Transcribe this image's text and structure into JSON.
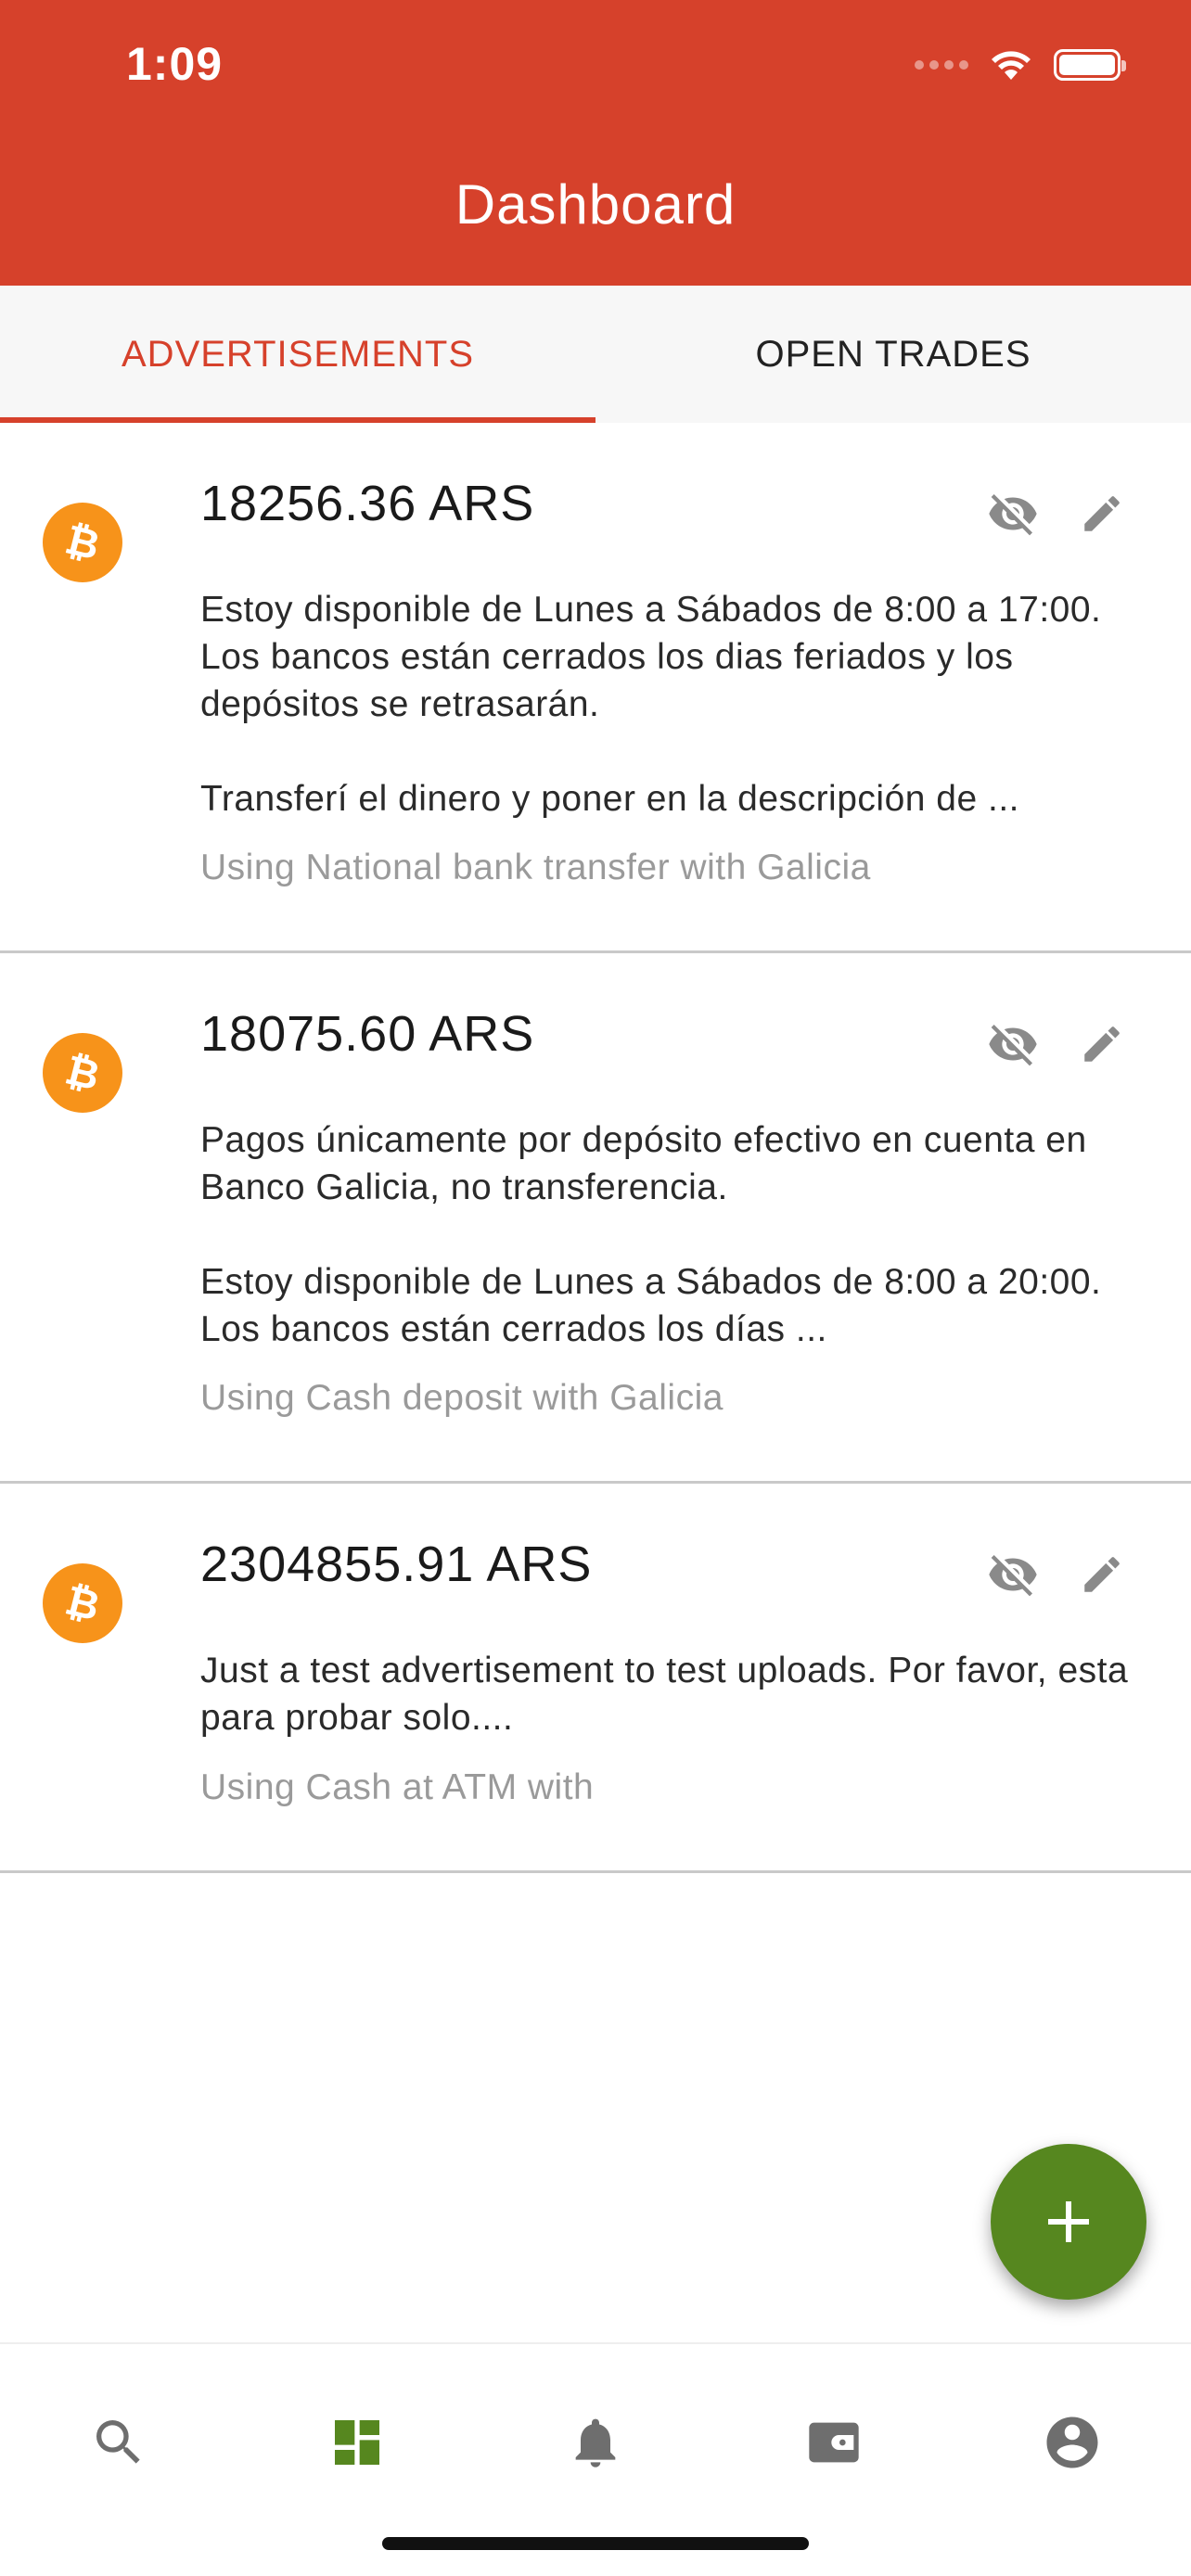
{
  "status_bar": {
    "time": "1:09"
  },
  "appbar": {
    "title": "Dashboard",
    "color": "#d6412b"
  },
  "tabs": [
    {
      "label": "ADVERTISEMENTS",
      "active": true
    },
    {
      "label": "OPEN TRADES",
      "active": false
    }
  ],
  "advertisements": [
    {
      "price": "18256.36 ARS",
      "description": "Estoy disponible de Lunes a Sábados de 8:00 a 17:00. Los bancos están cerrados los dias feriados y los depósitos se retrasarán.\n\nTransferí el dinero y poner en la descripción de ...",
      "payment": "Using National bank transfer with Galicia",
      "icon": "bitcoin-icon"
    },
    {
      "price": "18075.60 ARS",
      "description": "Pagos únicamente por depósito efectivo en cuenta en Banco Galicia, no transferencia.\n\nEstoy disponible de Lunes a Sábados de 8:00 a 20:00. Los bancos están cerrados los días ...",
      "payment": "Using Cash deposit with Galicia",
      "icon": "bitcoin-icon"
    },
    {
      "price": "2304855.91 ARS",
      "description": "Just a test advertisement to test uploads. Por favor, esta para probar solo....",
      "payment": "Using Cash at ATM with",
      "icon": "bitcoin-icon"
    }
  ],
  "fab": {
    "icon": "plus-icon",
    "color": "#56871f"
  },
  "bottom_nav": [
    {
      "icon": "search-icon",
      "active": false
    },
    {
      "icon": "dashboard-icon",
      "active": true
    },
    {
      "icon": "bell-icon",
      "active": false
    },
    {
      "icon": "wallet-icon",
      "active": false
    },
    {
      "icon": "account-icon",
      "active": false
    }
  ],
  "colors": {
    "bitcoin": "#f7931a",
    "nav_active": "#56871f",
    "nav_inactive": "#6e6e6e"
  }
}
